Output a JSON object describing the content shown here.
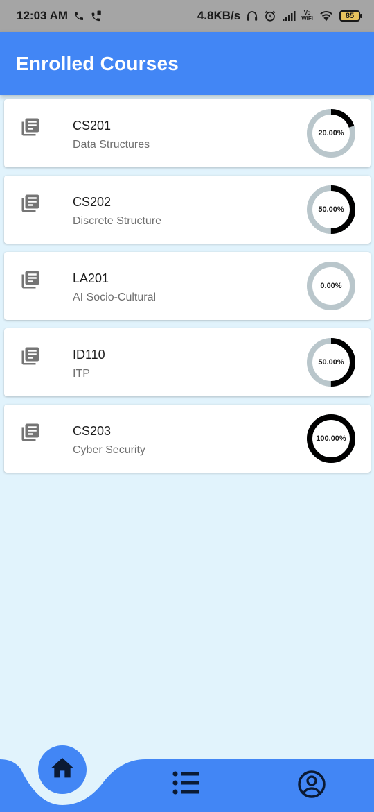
{
  "status_bar": {
    "time": "12:03 AM",
    "network_speed": "4.8KB/s",
    "volte_top": "Vo",
    "volte_bottom": "WiFi",
    "battery_level": "85",
    "icons": [
      "phone-icon",
      "call-forward-icon",
      "headset-icon",
      "alarm-icon",
      "signal-icon",
      "volte-wifi-icon",
      "wifi-icon",
      "battery-icon"
    ]
  },
  "app_bar": {
    "title": "Enrolled Courses"
  },
  "courses": [
    {
      "code": "CS201",
      "name": "Data Structures",
      "progress": 0.2,
      "progress_label": "20.00%"
    },
    {
      "code": "CS202",
      "name": "Discrete Structure",
      "progress": 0.5,
      "progress_label": "50.00%"
    },
    {
      "code": "LA201",
      "name": "AI Socio-Cultural",
      "progress": 0.0,
      "progress_label": "0.00%"
    },
    {
      "code": "ID110",
      "name": "ITP",
      "progress": 0.5,
      "progress_label": "50.00%"
    },
    {
      "code": "CS203",
      "name": "Cyber Security",
      "progress": 1.0,
      "progress_label": "100.00%"
    }
  ],
  "course_icon": "library-books-icon",
  "bottom_nav": {
    "items": [
      {
        "icon": "home-icon",
        "selected": true
      },
      {
        "icon": "list-icon",
        "selected": false
      },
      {
        "icon": "account-circle-icon",
        "selected": false
      }
    ]
  },
  "colors": {
    "primary": "#4286f5",
    "background": "#e1f3fc",
    "progress_track": "#b9c6cb",
    "progress_fill": "#000000",
    "status_bar": "#a5a5a5"
  }
}
